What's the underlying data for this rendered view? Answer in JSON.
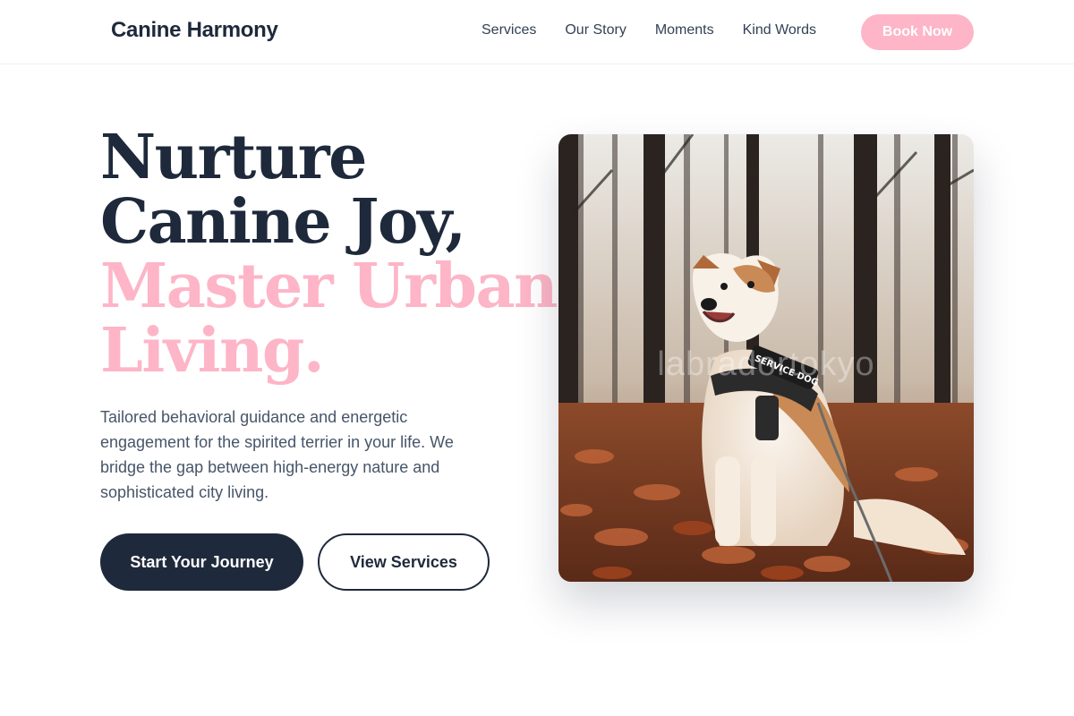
{
  "brand": {
    "name": "Canine Harmony"
  },
  "nav": {
    "links": [
      "Services",
      "Our Story",
      "Moments",
      "Kind Words"
    ],
    "cta_label": "Book Now"
  },
  "hero": {
    "title_lines": [
      "Nurture",
      "Canine Joy,"
    ],
    "title_accent_lines": [
      "Master Urban",
      "Living."
    ],
    "description": "Tailored behavioral guidance and energetic engagement for the spirited terrier in your life. We bridge the gap between high-energy nature and sophisticated city living.",
    "primary_button": "Start Your Journey",
    "secondary_button": "View Services",
    "image": {
      "subject": "dog in autumn forest wearing harness",
      "harness_text": "SERVICE DOG",
      "watermark": "labradortokyo"
    }
  },
  "colors": {
    "navy": "#1e293b",
    "pink": "#fdb5c7",
    "body_text": "#475569"
  }
}
